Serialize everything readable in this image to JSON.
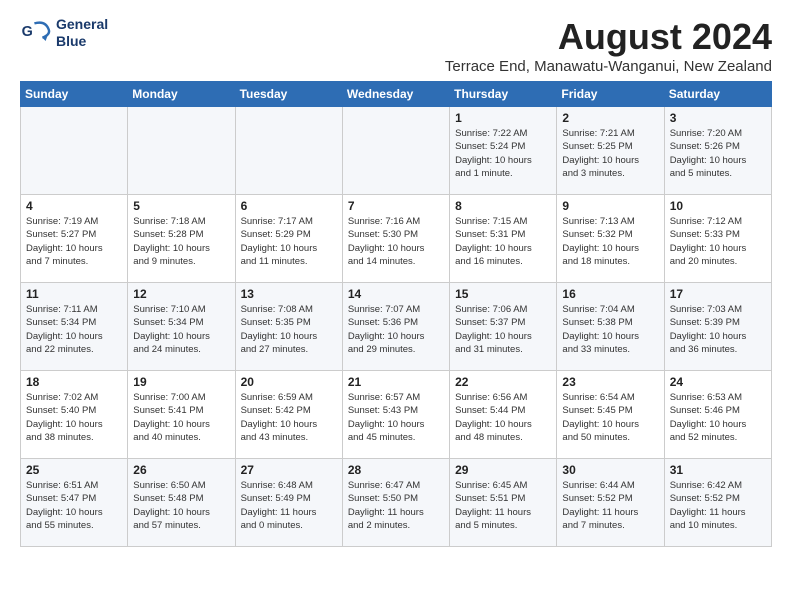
{
  "header": {
    "logo_line1": "General",
    "logo_line2": "Blue",
    "month": "August 2024",
    "location": "Terrace End, Manawatu-Wanganui, New Zealand"
  },
  "weekdays": [
    "Sunday",
    "Monday",
    "Tuesday",
    "Wednesday",
    "Thursday",
    "Friday",
    "Saturday"
  ],
  "weeks": [
    [
      {
        "day": "",
        "info": ""
      },
      {
        "day": "",
        "info": ""
      },
      {
        "day": "",
        "info": ""
      },
      {
        "day": "",
        "info": ""
      },
      {
        "day": "1",
        "info": "Sunrise: 7:22 AM\nSunset: 5:24 PM\nDaylight: 10 hours\nand 1 minute."
      },
      {
        "day": "2",
        "info": "Sunrise: 7:21 AM\nSunset: 5:25 PM\nDaylight: 10 hours\nand 3 minutes."
      },
      {
        "day": "3",
        "info": "Sunrise: 7:20 AM\nSunset: 5:26 PM\nDaylight: 10 hours\nand 5 minutes."
      }
    ],
    [
      {
        "day": "4",
        "info": "Sunrise: 7:19 AM\nSunset: 5:27 PM\nDaylight: 10 hours\nand 7 minutes."
      },
      {
        "day": "5",
        "info": "Sunrise: 7:18 AM\nSunset: 5:28 PM\nDaylight: 10 hours\nand 9 minutes."
      },
      {
        "day": "6",
        "info": "Sunrise: 7:17 AM\nSunset: 5:29 PM\nDaylight: 10 hours\nand 11 minutes."
      },
      {
        "day": "7",
        "info": "Sunrise: 7:16 AM\nSunset: 5:30 PM\nDaylight: 10 hours\nand 14 minutes."
      },
      {
        "day": "8",
        "info": "Sunrise: 7:15 AM\nSunset: 5:31 PM\nDaylight: 10 hours\nand 16 minutes."
      },
      {
        "day": "9",
        "info": "Sunrise: 7:13 AM\nSunset: 5:32 PM\nDaylight: 10 hours\nand 18 minutes."
      },
      {
        "day": "10",
        "info": "Sunrise: 7:12 AM\nSunset: 5:33 PM\nDaylight: 10 hours\nand 20 minutes."
      }
    ],
    [
      {
        "day": "11",
        "info": "Sunrise: 7:11 AM\nSunset: 5:34 PM\nDaylight: 10 hours\nand 22 minutes."
      },
      {
        "day": "12",
        "info": "Sunrise: 7:10 AM\nSunset: 5:34 PM\nDaylight: 10 hours\nand 24 minutes."
      },
      {
        "day": "13",
        "info": "Sunrise: 7:08 AM\nSunset: 5:35 PM\nDaylight: 10 hours\nand 27 minutes."
      },
      {
        "day": "14",
        "info": "Sunrise: 7:07 AM\nSunset: 5:36 PM\nDaylight: 10 hours\nand 29 minutes."
      },
      {
        "day": "15",
        "info": "Sunrise: 7:06 AM\nSunset: 5:37 PM\nDaylight: 10 hours\nand 31 minutes."
      },
      {
        "day": "16",
        "info": "Sunrise: 7:04 AM\nSunset: 5:38 PM\nDaylight: 10 hours\nand 33 minutes."
      },
      {
        "day": "17",
        "info": "Sunrise: 7:03 AM\nSunset: 5:39 PM\nDaylight: 10 hours\nand 36 minutes."
      }
    ],
    [
      {
        "day": "18",
        "info": "Sunrise: 7:02 AM\nSunset: 5:40 PM\nDaylight: 10 hours\nand 38 minutes."
      },
      {
        "day": "19",
        "info": "Sunrise: 7:00 AM\nSunset: 5:41 PM\nDaylight: 10 hours\nand 40 minutes."
      },
      {
        "day": "20",
        "info": "Sunrise: 6:59 AM\nSunset: 5:42 PM\nDaylight: 10 hours\nand 43 minutes."
      },
      {
        "day": "21",
        "info": "Sunrise: 6:57 AM\nSunset: 5:43 PM\nDaylight: 10 hours\nand 45 minutes."
      },
      {
        "day": "22",
        "info": "Sunrise: 6:56 AM\nSunset: 5:44 PM\nDaylight: 10 hours\nand 48 minutes."
      },
      {
        "day": "23",
        "info": "Sunrise: 6:54 AM\nSunset: 5:45 PM\nDaylight: 10 hours\nand 50 minutes."
      },
      {
        "day": "24",
        "info": "Sunrise: 6:53 AM\nSunset: 5:46 PM\nDaylight: 10 hours\nand 52 minutes."
      }
    ],
    [
      {
        "day": "25",
        "info": "Sunrise: 6:51 AM\nSunset: 5:47 PM\nDaylight: 10 hours\nand 55 minutes."
      },
      {
        "day": "26",
        "info": "Sunrise: 6:50 AM\nSunset: 5:48 PM\nDaylight: 10 hours\nand 57 minutes."
      },
      {
        "day": "27",
        "info": "Sunrise: 6:48 AM\nSunset: 5:49 PM\nDaylight: 11 hours\nand 0 minutes."
      },
      {
        "day": "28",
        "info": "Sunrise: 6:47 AM\nSunset: 5:50 PM\nDaylight: 11 hours\nand 2 minutes."
      },
      {
        "day": "29",
        "info": "Sunrise: 6:45 AM\nSunset: 5:51 PM\nDaylight: 11 hours\nand 5 minutes."
      },
      {
        "day": "30",
        "info": "Sunrise: 6:44 AM\nSunset: 5:52 PM\nDaylight: 11 hours\nand 7 minutes."
      },
      {
        "day": "31",
        "info": "Sunrise: 6:42 AM\nSunset: 5:52 PM\nDaylight: 11 hours\nand 10 minutes."
      }
    ]
  ]
}
